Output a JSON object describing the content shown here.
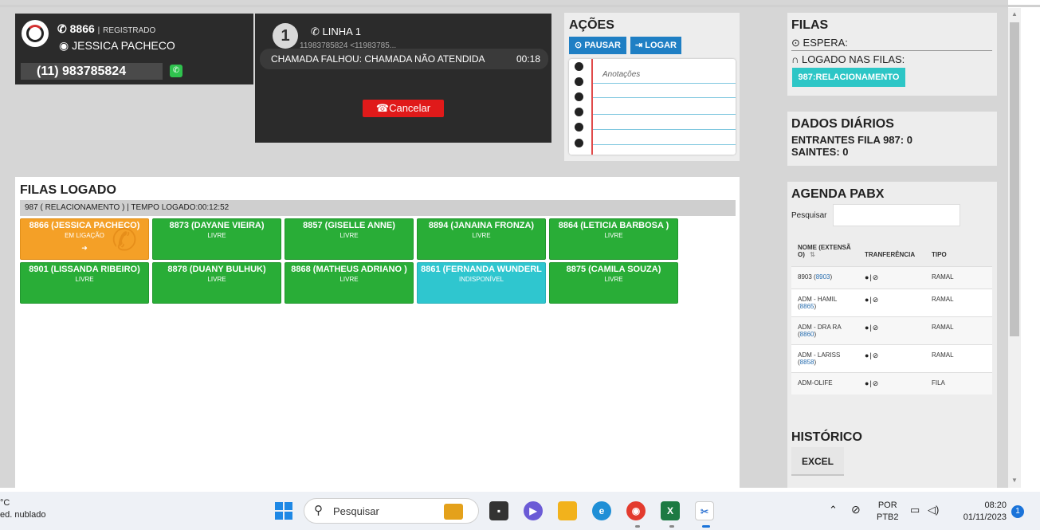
{
  "extension": {
    "number": "8866",
    "status": "REGISTRADO",
    "agent": "JESSICA PACHECO",
    "phone": "(11) 983785824"
  },
  "line": {
    "number": "1",
    "title": "LINHA 1",
    "caller": "11983785824 <11983785...",
    "message": "CHAMADA FALHOU: CHAMADA NÃO ATENDIDA",
    "timer": "00:18",
    "cancel_label": "Cancelar"
  },
  "acoes": {
    "title": "AÇÕES",
    "pause_label": "PAUSAR",
    "login_label": "LOGAR",
    "notes_label": "Anotações"
  },
  "filas": {
    "title": "FILAS",
    "espera_label": "ESPERA:",
    "logado_label": "LOGADO NAS FILAS:",
    "queue_badge": "987:RELACIONAMENTO"
  },
  "dados": {
    "title": "DADOS DIÁRIOS",
    "entrantes": "ENTRANTES FILA 987: 0",
    "saintes": "SAINTES: 0"
  },
  "agenda": {
    "title": "AGENDA PABX",
    "search_label": "Pesquisar",
    "search_value": "",
    "columns": [
      "NOME (EXTENSÃ O)",
      "TRANFERÊNCIA",
      "TIPO"
    ],
    "sort_icon": "⇅",
    "rows": [
      {
        "name": "8903",
        "ext": "8903",
        "type": "RAMAL"
      },
      {
        "name": "ADM - HAMIL",
        "ext": "8865",
        "type": "RAMAL"
      },
      {
        "name": "ADM - DRA RA",
        "ext": "8860",
        "type": "RAMAL"
      },
      {
        "name": "ADM - LARISS",
        "ext": "8858",
        "type": "RAMAL"
      },
      {
        "name": "ADM-OLIFE",
        "ext": "",
        "type": "FILA"
      }
    ]
  },
  "historico": {
    "title": "HISTÓRICO",
    "excel_label": "EXCEL"
  },
  "filas_logado": {
    "title": "FILAS LOGADO",
    "bar": "987 ( RELACIONAMENTO ) | TEMPO LOGADO:00:12:52",
    "agents": [
      {
        "name": "8866 (JESSICA PACHECO)",
        "status": "EM LIGAÇÃO",
        "color": "orange"
      },
      {
        "name": "8873 (DAYANE VIEIRA)",
        "status": "LIVRE",
        "color": "green"
      },
      {
        "name": "8857 (GISELLE ANNE)",
        "status": "LIVRE",
        "color": "green"
      },
      {
        "name": "8894 (JANAINA FRONZA)",
        "status": "LIVRE",
        "color": "green"
      },
      {
        "name": "8864 (LETICIA BARBOSA )",
        "status": "LIVRE",
        "color": "green"
      },
      {
        "name": "8901 (LISSANDA RIBEIRO)",
        "status": "LIVRE",
        "color": "green"
      },
      {
        "name": "8878 (DUANY BULHUK)",
        "status": "LIVRE",
        "color": "green"
      },
      {
        "name": "8868 (MATHEUS ADRIANO )",
        "status": "LIVRE",
        "color": "green"
      },
      {
        "name": "8861 (FERNANDA WUNDERL",
        "status": "INDISPONÍVEL",
        "color": "cyan"
      },
      {
        "name": "8875 (CAMILA SOUZA)",
        "status": "LIVRE",
        "color": "green"
      }
    ]
  },
  "taskbar": {
    "weather_temp": "°C",
    "weather_text": "ed. nublado",
    "search_placeholder": "Pesquisar",
    "lang_top": "POR",
    "lang_bottom": "PTB2",
    "time": "08:20",
    "date": "01/11/2023",
    "notifications": "1"
  },
  "colors": {
    "green": "#29ad37",
    "orange": "#f4a027",
    "cyan": "#2fc6cf",
    "blue_button": "#1f7fc4",
    "cancel_red": "#e01a1a"
  }
}
